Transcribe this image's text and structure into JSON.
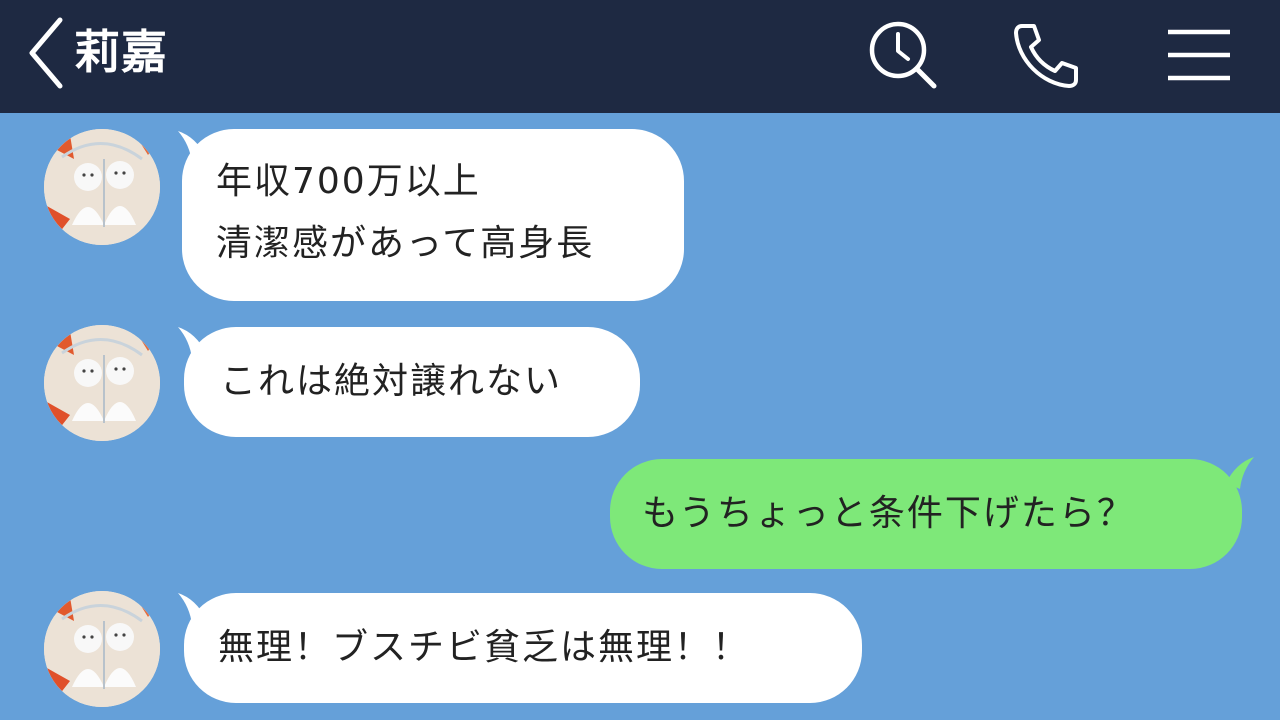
{
  "header": {
    "title": "莉嘉",
    "icons": [
      "back-chevron-icon",
      "search-history-icon",
      "phone-icon",
      "menu-icon"
    ]
  },
  "colors": {
    "header_bg": "#1e2942",
    "chat_bg": "#65a0d9",
    "incoming_bubble": "#ffffff",
    "outgoing_bubble": "#7ee879"
  },
  "messages": [
    {
      "sender": "莉嘉",
      "direction": "incoming",
      "lines": [
        "年収700万以上",
        "清潔感があって高身長"
      ]
    },
    {
      "sender": "莉嘉",
      "direction": "incoming",
      "lines": [
        "これは絶対譲れない"
      ]
    },
    {
      "sender": "me",
      "direction": "outgoing",
      "lines": [
        "もうちょっと条件下げたら？"
      ]
    },
    {
      "sender": "莉嘉",
      "direction": "incoming",
      "lines": [
        "無理！ブスチビ貧乏は無理！！"
      ]
    }
  ]
}
